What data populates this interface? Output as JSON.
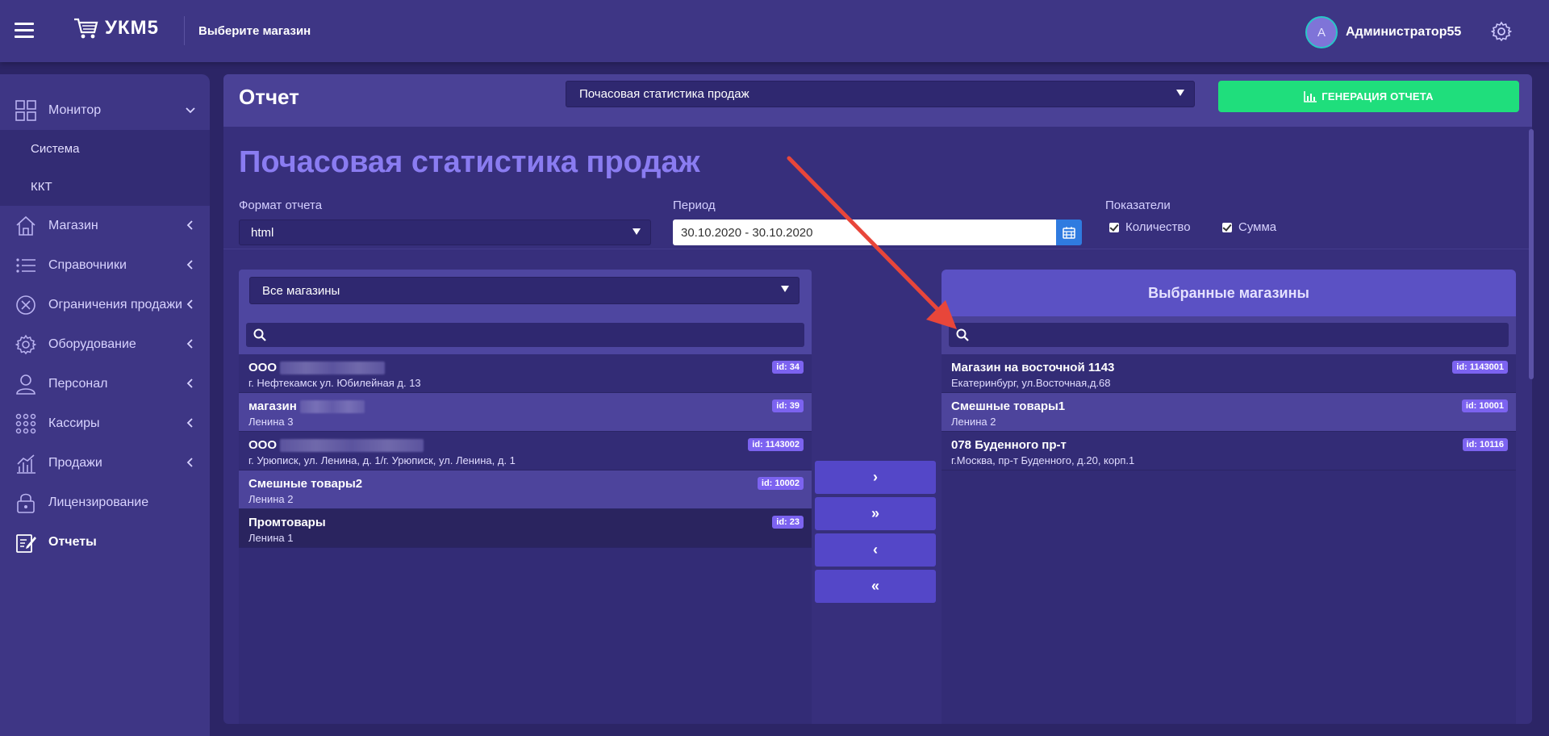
{
  "header": {
    "logo": "УКМ5",
    "store_select": "Выберите магазин",
    "avatar_letter": "А",
    "username": "Администратор55"
  },
  "sidebar": {
    "items": [
      {
        "label": "Монитор",
        "icon": "monitor-grid-icon",
        "expanded": true
      },
      {
        "label": "Магазин",
        "icon": "home-icon"
      },
      {
        "label": "Справочники",
        "icon": "list-icon"
      },
      {
        "label": "Ограничения продажи",
        "icon": "cancel-circle-icon"
      },
      {
        "label": "Оборудование",
        "icon": "gear-icon"
      },
      {
        "label": "Персонал",
        "icon": "user-icon"
      },
      {
        "label": "Кассиры",
        "icon": "dots-grid-icon"
      },
      {
        "label": "Продажи",
        "icon": "chart-icon"
      },
      {
        "label": "Лицензирование",
        "icon": "lock-icon"
      },
      {
        "label": "Отчеты",
        "icon": "report-edit-icon",
        "active": true
      }
    ],
    "submenu": [
      "Система",
      "ККТ"
    ]
  },
  "main": {
    "page_title": "Отчет",
    "report_select": "Почасовая статистика продаж",
    "generate_button": "ГЕНЕРАЦИЯ ОТЧЕТА",
    "report_title": "Почасовая статистика продаж",
    "format_label": "Формат отчета",
    "format_value": "html",
    "period_label": "Период",
    "period_value": "30.10.2020 - 30.10.2020",
    "indicators_label": "Показатели",
    "indicators": [
      {
        "label": "Количество",
        "checked": true
      },
      {
        "label": "Сумма",
        "checked": true
      }
    ]
  },
  "left_panel": {
    "store_filter": "Все магазины",
    "items": [
      {
        "name": "ООО",
        "address": "г. Нефтекамск ул. Юбилейная д. 13",
        "id": "id: 34"
      },
      {
        "name": "магазин",
        "address": "Ленина 3",
        "id": "id: 39"
      },
      {
        "name": "ООО",
        "address": "г. Урюписк, ул. Ленина, д. 1/г. Урюписк, ул. Ленина, д. 1",
        "id": "id: 1143002"
      },
      {
        "name": "Смешные товары2",
        "address": "Ленина 2",
        "id": "id: 10002"
      },
      {
        "name": "Промтовары",
        "address": "Ленина 1",
        "id": "id: 23"
      }
    ]
  },
  "move_buttons": [
    {
      "label": "›",
      "name": "move-right-button"
    },
    {
      "label": "»",
      "name": "move-all-right-button"
    },
    {
      "label": "‹",
      "name": "move-left-button"
    },
    {
      "label": "«",
      "name": "move-all-left-button"
    }
  ],
  "right_panel": {
    "title": "Выбранные магазины",
    "items": [
      {
        "name": "Магазин на восточной 1143",
        "address": "Екатеринбург, ул.Восточная,д.68",
        "id": "id: 1143001"
      },
      {
        "name": "Смешные товары1",
        "address": "Ленина 2",
        "id": "id: 10001"
      },
      {
        "name": "078 Буденного пр-т",
        "address": "г.Москва, пр-т Буденного, д.20, корп.1",
        "id": "id: 10116"
      }
    ]
  },
  "colors": {
    "accent": "#1fde7c",
    "title": "#8a7cf1",
    "badge": "#7c63f0",
    "annotation_arrow": "#e8463a"
  }
}
